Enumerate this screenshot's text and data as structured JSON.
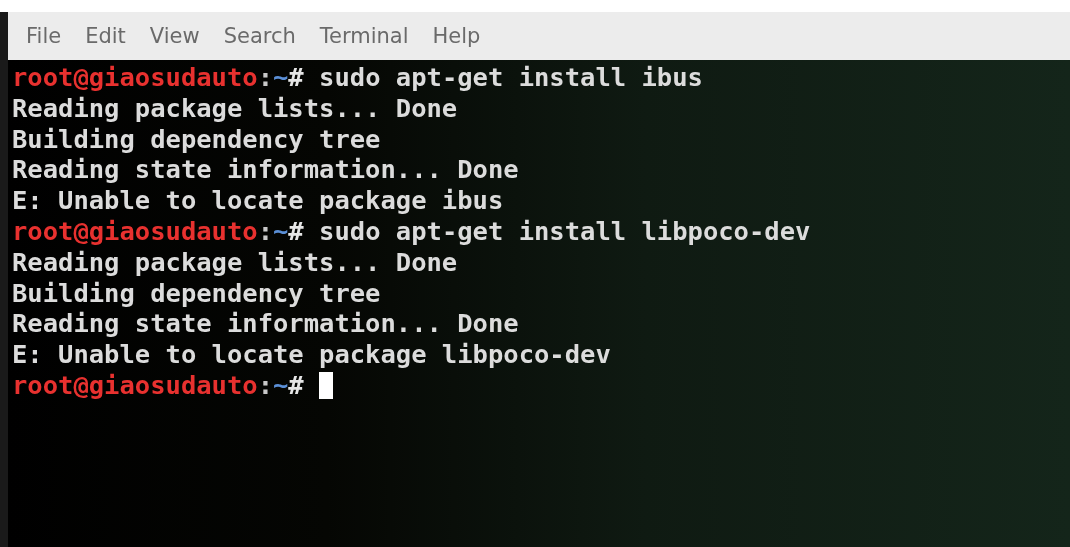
{
  "menu": [
    "File",
    "Edit",
    "View",
    "Search",
    "Terminal",
    "Help"
  ],
  "lines": [
    {
      "kind": "prompt",
      "user": "root@giaosudauto",
      "sep": ":",
      "path": "~",
      "sign": "#",
      "command": "sudo apt-get install ibus"
    },
    {
      "kind": "output",
      "text": "Reading package lists... Done"
    },
    {
      "kind": "output",
      "text": "Building dependency tree"
    },
    {
      "kind": "output",
      "text": "Reading state information... Done"
    },
    {
      "kind": "output",
      "text": "E: Unable to locate package ibus"
    },
    {
      "kind": "prompt",
      "user": "root@giaosudauto",
      "sep": ":",
      "path": "~",
      "sign": "#",
      "command": "sudo apt-get install libpoco-dev"
    },
    {
      "kind": "output",
      "text": "Reading package lists... Done"
    },
    {
      "kind": "output",
      "text": "Building dependency tree"
    },
    {
      "kind": "output",
      "text": "Reading state information... Done"
    },
    {
      "kind": "output",
      "text": "E: Unable to locate package libpoco-dev"
    },
    {
      "kind": "prompt",
      "user": "root@giaosudauto",
      "sep": ":",
      "path": "~",
      "sign": "#",
      "cursor": true
    }
  ]
}
